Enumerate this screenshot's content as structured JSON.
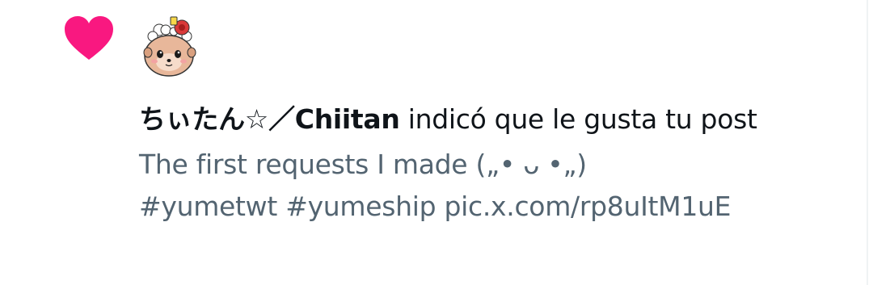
{
  "notification": {
    "type_icon": "heart-icon",
    "like_color": "#f91880",
    "user_name": "ちぃたん☆／Chiitan",
    "action_text": " indicó que le gusta tu post",
    "post_preview": "The first requests I made („• ᴗ •„)",
    "hashtags": [
      "#yumetwt",
      "#yumeship"
    ],
    "media_link": "pic.x.com/rp8uItM1uE"
  }
}
